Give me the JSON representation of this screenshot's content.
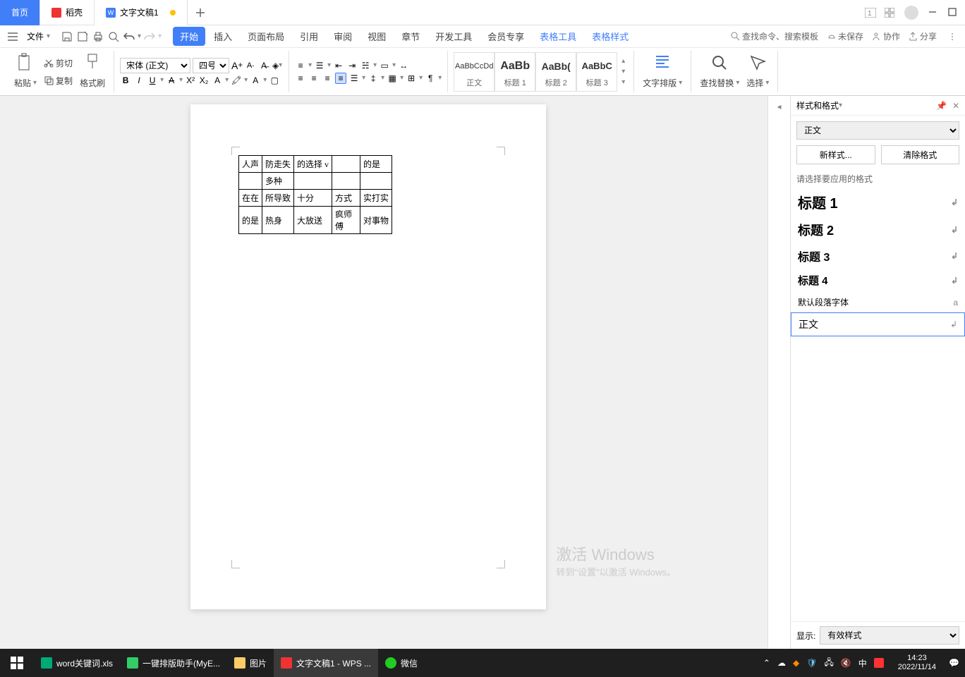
{
  "tabs": {
    "home": "首页",
    "daoke": "稻壳",
    "doc": "文字文稿1"
  },
  "file_menu": "文件",
  "menu": {
    "start": "开始",
    "insert": "插入",
    "page_layout": "页面布局",
    "reference": "引用",
    "review": "审阅",
    "view": "视图",
    "chapter": "章节",
    "dev": "开发工具",
    "member": "会员专享",
    "table_tools": "表格工具",
    "table_style": "表格样式"
  },
  "menubar_right": {
    "search_placeholder": "查找命令、搜索模板",
    "unsaved": "未保存",
    "collab": "协作",
    "share": "分享"
  },
  "ribbon": {
    "paste": "粘贴",
    "cut": "剪切",
    "copy": "复制",
    "format_painter": "格式刷",
    "font_name": "宋体 (正文)",
    "font_size": "四号",
    "styles": {
      "body": "正文",
      "h1": "标题 1",
      "h2": "标题 2",
      "h3": "标题 3"
    },
    "text_layout": "文字排版",
    "find_replace": "查找替换",
    "select": "选择"
  },
  "sidepanel": {
    "title": "样式和格式",
    "current": "正文",
    "new_style": "新样式...",
    "clear_format": "清除格式",
    "prompt": "请选择要应用的格式",
    "items": {
      "h1": "标题 1",
      "h2": "标题 2",
      "h3": "标题 3",
      "h4": "标题 4",
      "default_font": "默认段落字体",
      "body": "正文"
    },
    "show": "显示:",
    "show_value": "有效样式"
  },
  "table": [
    [
      "人声",
      "防走失",
      "的选择 v",
      "",
      "的是"
    ],
    [
      "",
      "多种",
      "",
      "",
      ""
    ],
    [
      "在在",
      "所导致",
      "十分",
      "方式",
      "实打实"
    ],
    [
      "的是",
      "热身",
      "大放送",
      "疯师傅",
      "对事物"
    ]
  ],
  "watermark": {
    "line1": "激活 Windows",
    "line2": "转到\"设置\"以激活 Windows。"
  },
  "taskbar": {
    "items": {
      "word": "word关键词.xls",
      "helper": "一键排版助手(MyE...",
      "pics": "图片",
      "wps": "文字文稿1 - WPS ...",
      "wechat": "微信"
    },
    "ime": "中",
    "time": "14:23",
    "date": "2022/11/14"
  }
}
